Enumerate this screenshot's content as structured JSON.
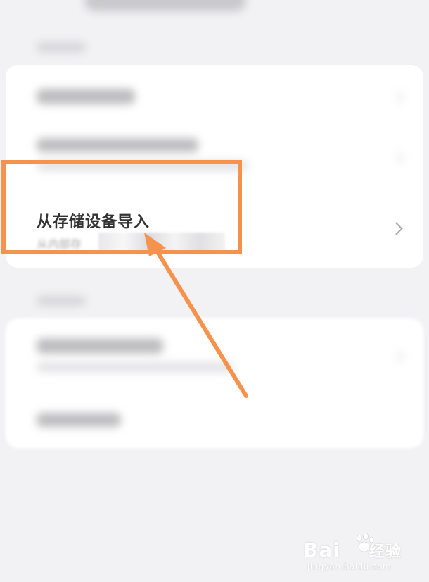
{
  "list": {
    "import_item": {
      "title": "从存储设备导入",
      "subtitle": "从内部存"
    }
  },
  "annotation": {
    "highlight_color": "#f5924d",
    "arrow_color": "#f5924d"
  },
  "watermark": {
    "brand_text": "Bai",
    "brand_text2": "经验",
    "sub_text": "jingyan.baidu.com"
  }
}
